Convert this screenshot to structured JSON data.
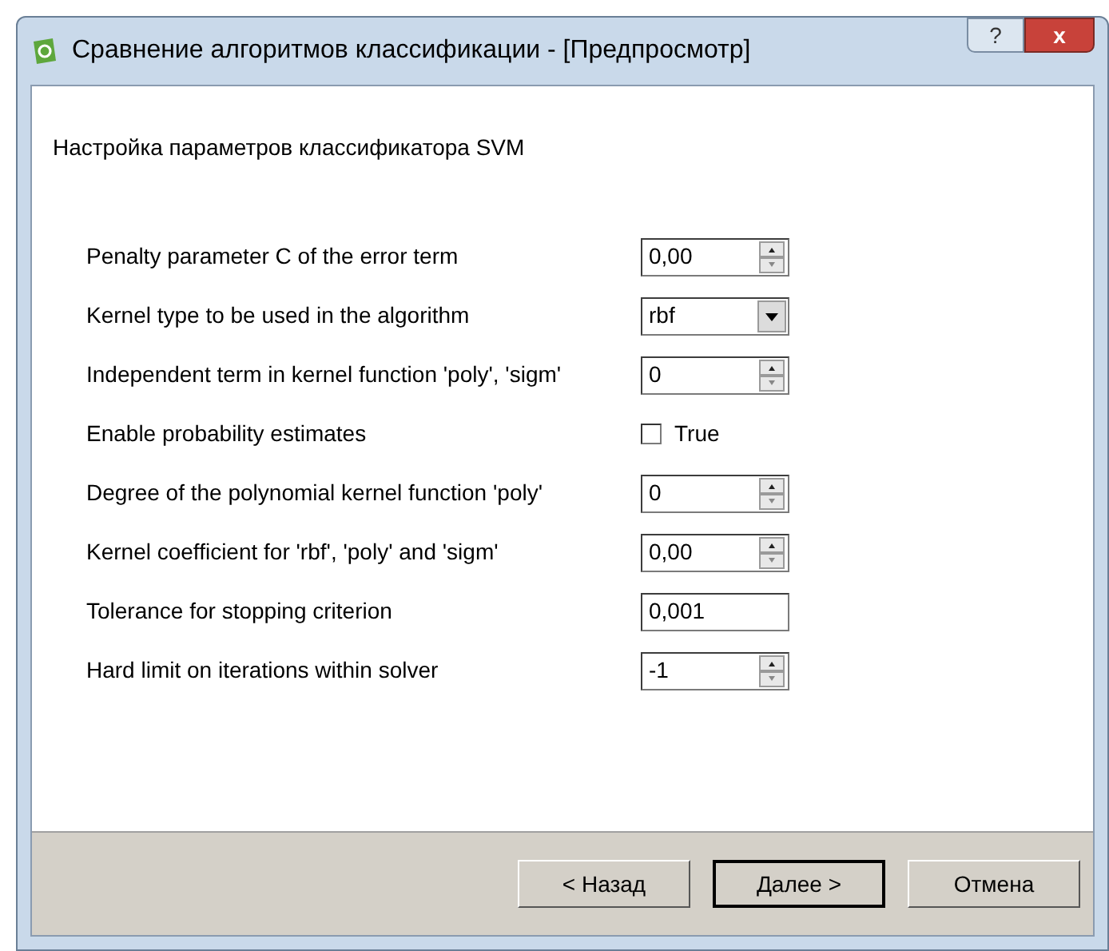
{
  "window": {
    "title": "Сравнение алгоритмов классификации - [Предпросмотр]",
    "help_button": "?",
    "close_button": "x"
  },
  "page": {
    "heading": "Настройка параметров классификатора SVM"
  },
  "parameters": [
    {
      "label": "Penalty parameter C of the error term",
      "kind": "spin",
      "value": "0,00"
    },
    {
      "label": "Kernel type to be used in the algorithm",
      "kind": "combo",
      "value": "rbf"
    },
    {
      "label": "Independent term in kernel function 'poly', 'sigm'",
      "kind": "spin",
      "value": "0"
    },
    {
      "label": "Enable probability estimates",
      "kind": "checkbox",
      "value": "True",
      "checked": false
    },
    {
      "label": "Degree of the polynomial kernel function 'poly'",
      "kind": "spin",
      "value": "0"
    },
    {
      "label": "Kernel coefficient for 'rbf', 'poly' and 'sigm'",
      "kind": "spin",
      "value": "0,00"
    },
    {
      "label": "Tolerance for stopping criterion",
      "kind": "text",
      "value": "0,001"
    },
    {
      "label": "Hard limit on iterations within solver",
      "kind": "spin",
      "value": "-1"
    }
  ],
  "buttons": [
    {
      "label": "< Назад",
      "default": false
    },
    {
      "label": "Далее >",
      "default": true
    },
    {
      "label": "Отмена",
      "default": false
    }
  ]
}
